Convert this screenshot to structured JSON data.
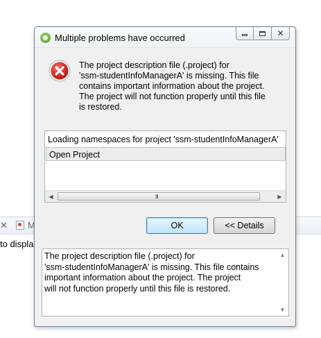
{
  "background": {
    "tab_close_glyph": "✕",
    "tab_letter": "M",
    "partial_text": "to displa"
  },
  "dialog": {
    "title": "Multiple problems have occurred",
    "window_controls": {
      "minimize": "minimize-icon",
      "maximize": "maximize-icon",
      "close": "close-icon",
      "close_glyph": "✕"
    },
    "icon": "error-icon",
    "message": "The project description file (.project) for\n'ssm-studentInfoManagerA' is missing.  This file\ncontains important information about the project.\nThe project will not function properly until this file\nis restored.",
    "problems_list": [
      "Loading namespaces for project 'ssm-studentInfoManagerA'",
      "Open Project"
    ],
    "scrollbar": {
      "left_arrow": "◀",
      "right_arrow": "▶",
      "grip": "III"
    },
    "buttons": {
      "ok": "OK",
      "details": "<< Details"
    },
    "details_text": "The project description file (.project) for\n'ssm-studentInfoManagerA' is missing.  This file contains\nimportant information about the project.  The project\nwill not function properly until this file is restored.",
    "details_scroll": {
      "up_arrow": "▲",
      "down_arrow": "▼"
    }
  },
  "colors": {
    "ok_button_border": "#3c7fb1",
    "error_red": "#d9302c"
  }
}
